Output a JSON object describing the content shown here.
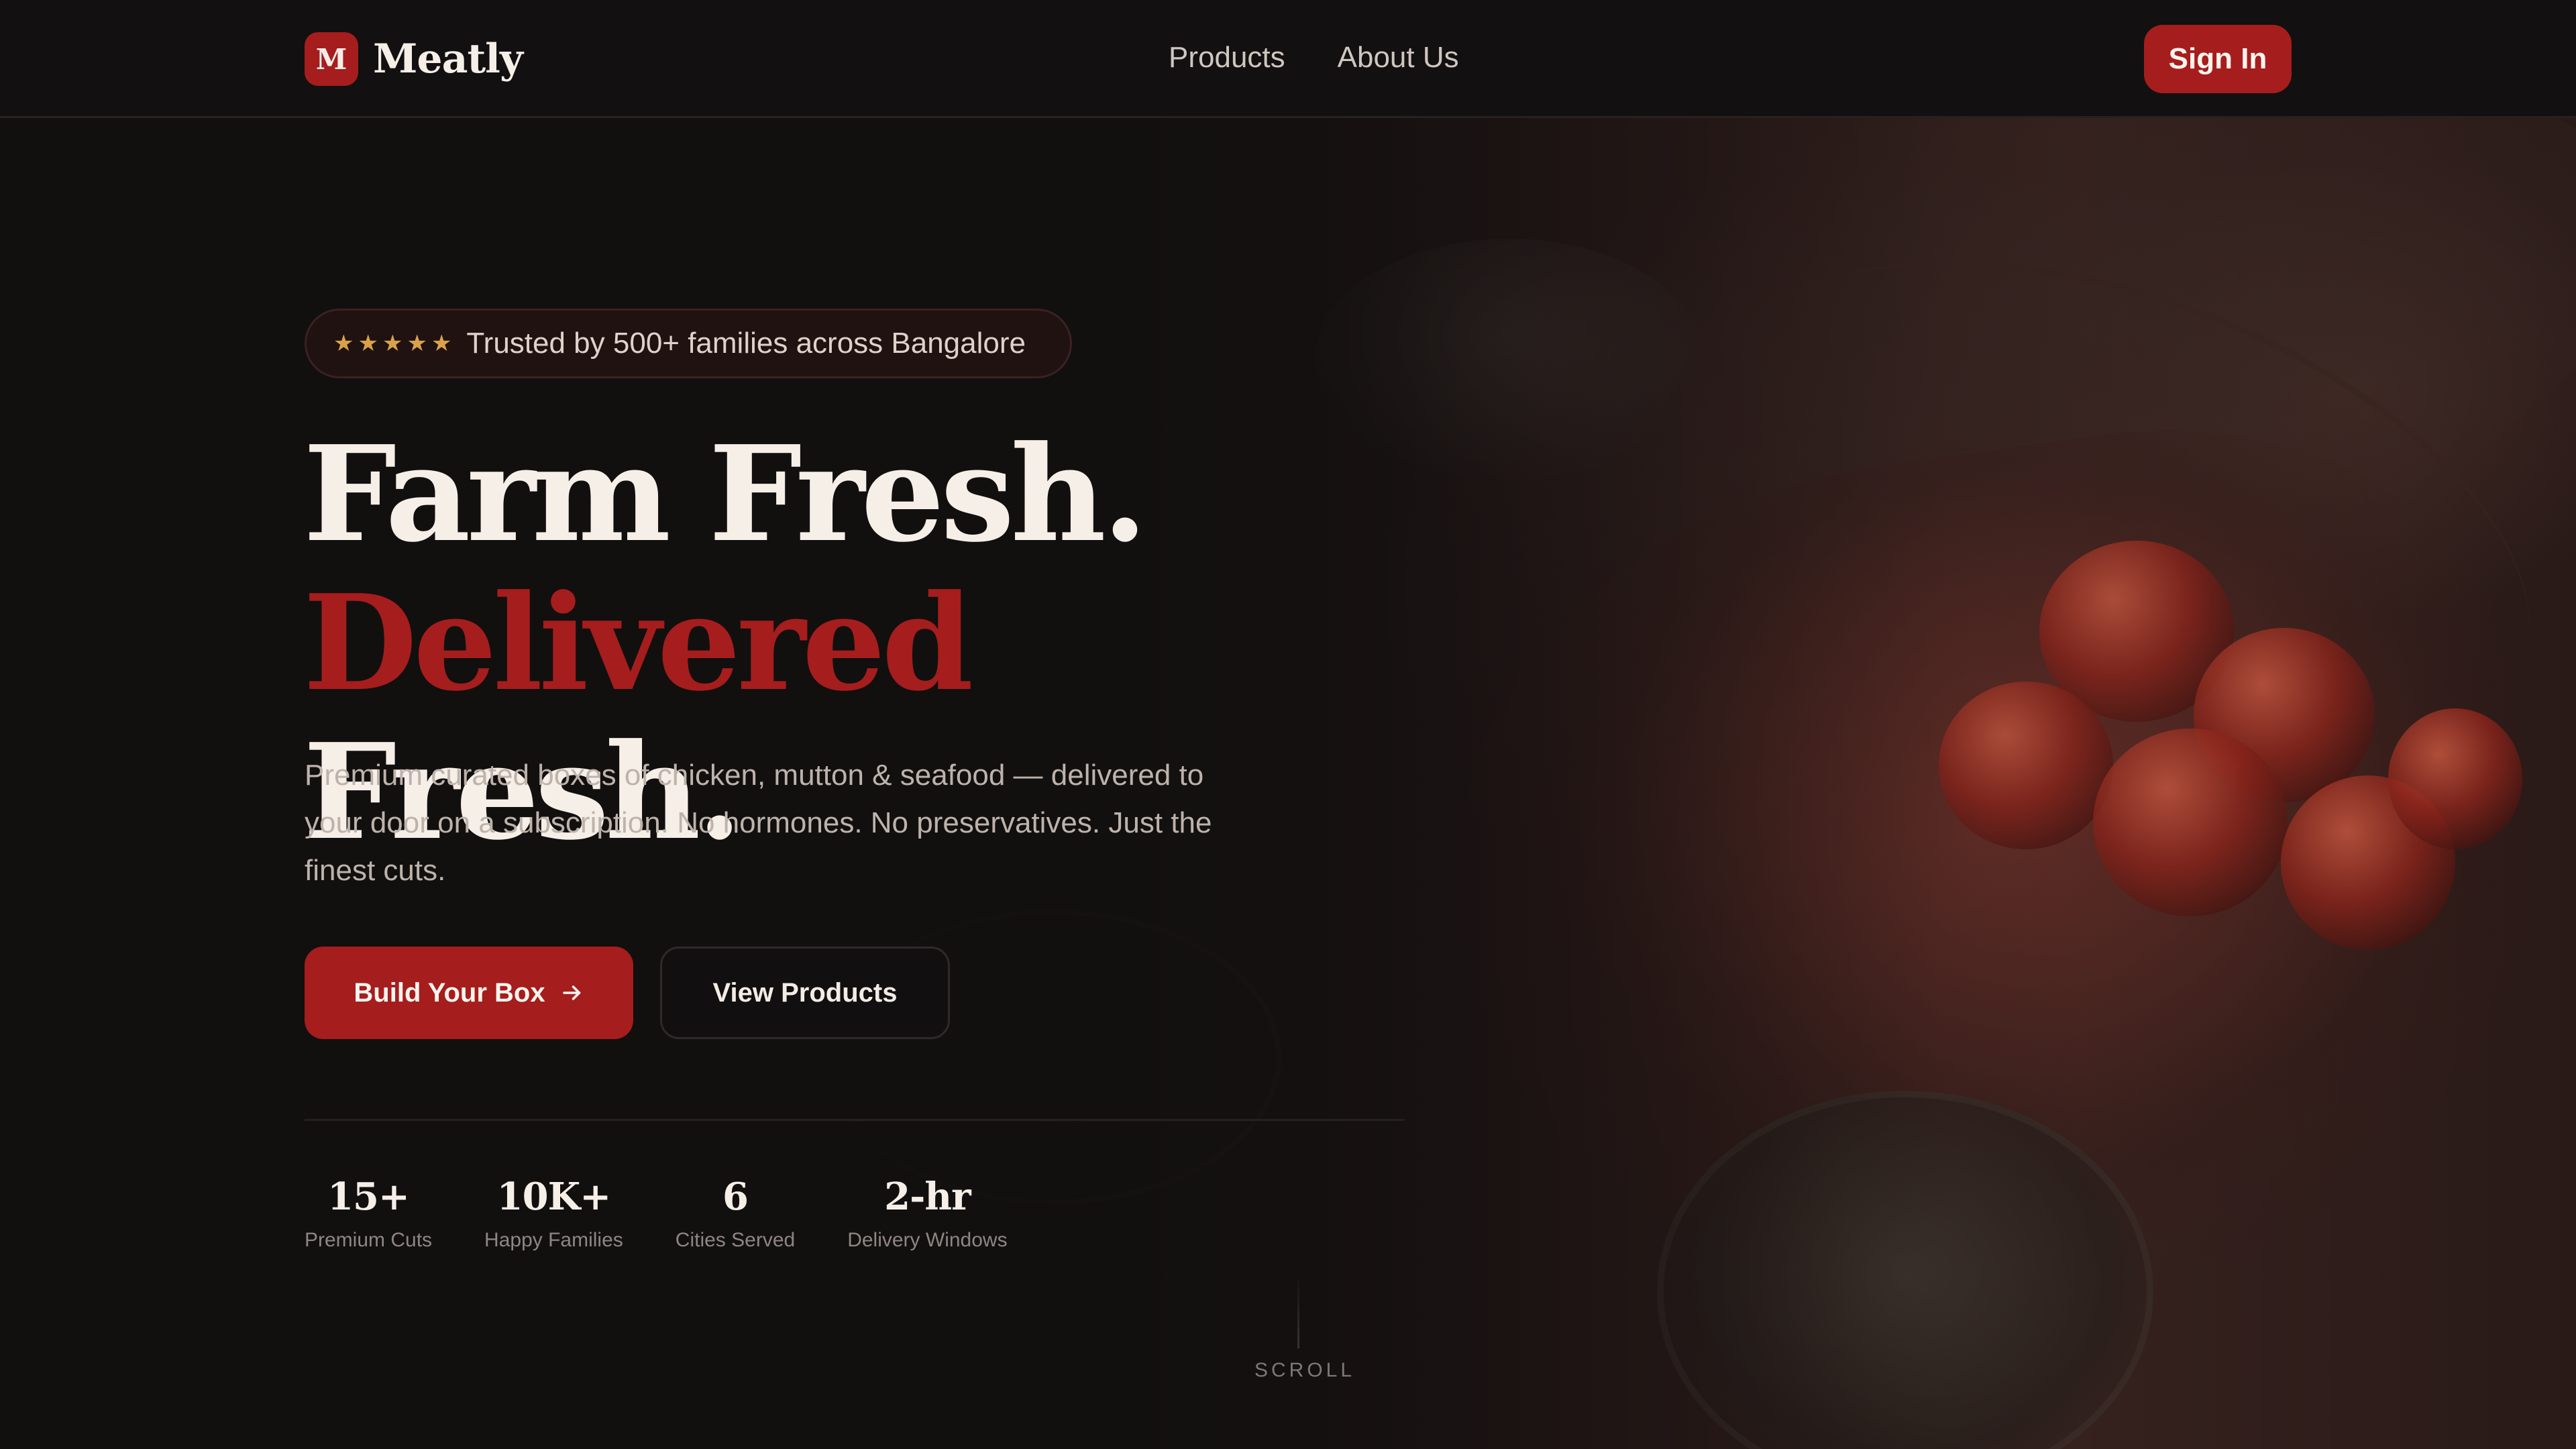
{
  "brand": {
    "logo_letter": "M",
    "name": "Meatly",
    "accent_color": "#a51d1d"
  },
  "nav": {
    "links": [
      {
        "label": "Products"
      },
      {
        "label": "About Us"
      }
    ],
    "signin_label": "Sign In"
  },
  "hero": {
    "badge": {
      "stars": 5,
      "star_icon": "star-icon",
      "text": "Trusted by 500+ families across Bangalore"
    },
    "headline": {
      "line1": "Farm Fresh.",
      "line2_accent": "Delivered",
      "line2_rest": "Fresh."
    },
    "subcopy": "Premium curated boxes of chicken, mutton & seafood — delivered to your door on a subscription. No hormones. No preservatives. Just the finest cuts.",
    "primary_button": {
      "label": "Build Your Box",
      "icon": "arrow-right-icon"
    },
    "secondary_button": {
      "label": "View Products"
    },
    "stats": [
      {
        "value": "15+",
        "label": "Premium Cuts"
      },
      {
        "value": "10K+",
        "label": "Happy Families"
      },
      {
        "value": "6",
        "label": "Cities Served"
      },
      {
        "value": "2-hr",
        "label": "Delivery Windows"
      }
    ],
    "scroll_label": "SCROLL"
  }
}
